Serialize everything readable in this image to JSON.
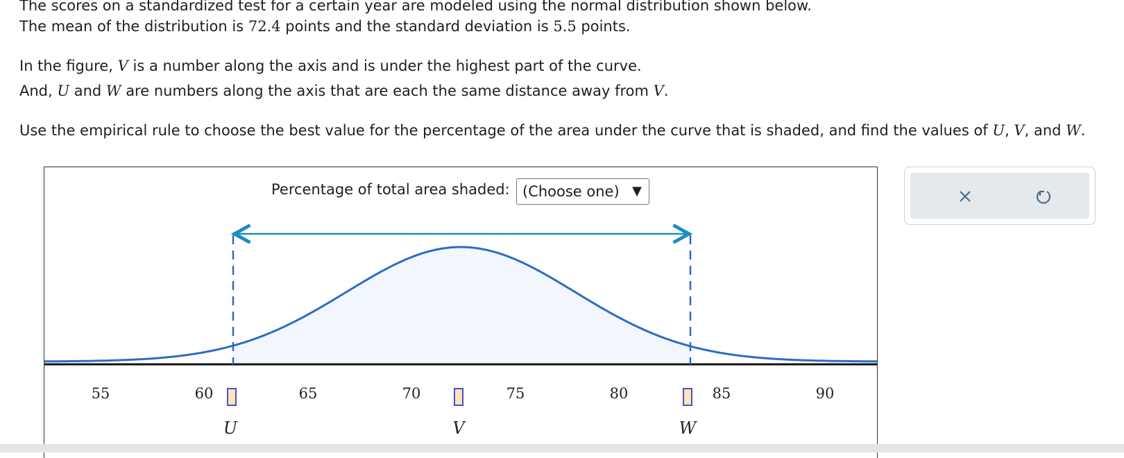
{
  "intro": {
    "line1": "The scores on a standardized test for a certain year are modeled using the normal distribution shown below.",
    "line2_pre": "The mean of the distribution is ",
    "mean": "72.4",
    "line2_mid": " points and the standard deviation is ",
    "sd": "5.5",
    "line2_post": " points.",
    "line3_pre": "In the figure, ",
    "line3_var": "V",
    "line3_post": " is a number along the axis and is under the highest part of the curve.",
    "line4_pre": "And, ",
    "line4_var1": "U",
    "line4_mid1": " and ",
    "line4_var2": "W",
    "line4_mid2": " are numbers along the axis that are each the same distance away from ",
    "line4_var3": "V",
    "line4_post": ".",
    "line5_pre": "Use the empirical rule to choose the best value for the percentage of the area under the curve that is shaded, and find the values of ",
    "line5_var1": "U",
    "line5_sep1": ", ",
    "line5_var2": "V",
    "line5_sep2": ", and ",
    "line5_var3": "W",
    "line5_post": "."
  },
  "figure": {
    "pct_label": "Percentage of total area shaded:",
    "pct_select_value": "(Choose one)",
    "pct_select_arrow": "▼",
    "tick_labels": [
      "55",
      "60",
      "65",
      "70",
      "75",
      "80",
      "85",
      "90"
    ],
    "var_labels": [
      "U",
      "V",
      "W"
    ],
    "curve_color": "#2b6cc4",
    "arrow_color": "#1e8dbf",
    "shade_color": "#f2f6fd"
  },
  "tools": {
    "clear_icon": "close-icon",
    "undo_icon": "undo-icon"
  }
}
